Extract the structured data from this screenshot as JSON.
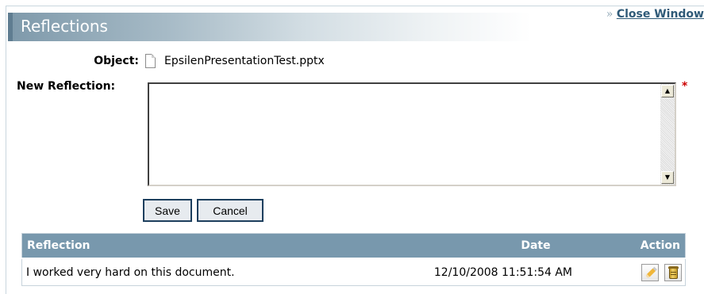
{
  "header": {
    "title": "Reflections"
  },
  "close_link": {
    "prefix": "»",
    "label": "Close Window"
  },
  "form": {
    "object_label": "Object:",
    "object_value": "EpsilenPresentationTest.pptx",
    "object_icon": "document-icon",
    "new_reflection_label": "New Reflection:",
    "new_reflection_value": "",
    "required_marker": "*",
    "save_label": "Save",
    "cancel_label": "Cancel"
  },
  "table": {
    "columns": [
      "Reflection",
      "Date",
      "Action"
    ],
    "rows": [
      {
        "reflection": "I worked very hard on this document.",
        "date": "12/10/2008 11:51:54 AM",
        "actions": [
          "edit-pencil-icon",
          "delete-can-icon"
        ]
      }
    ]
  },
  "colors": {
    "header_accent": "#5f7d91",
    "table_header": "#7898ad",
    "link": "#2f5a78",
    "required": "#cc0000"
  }
}
